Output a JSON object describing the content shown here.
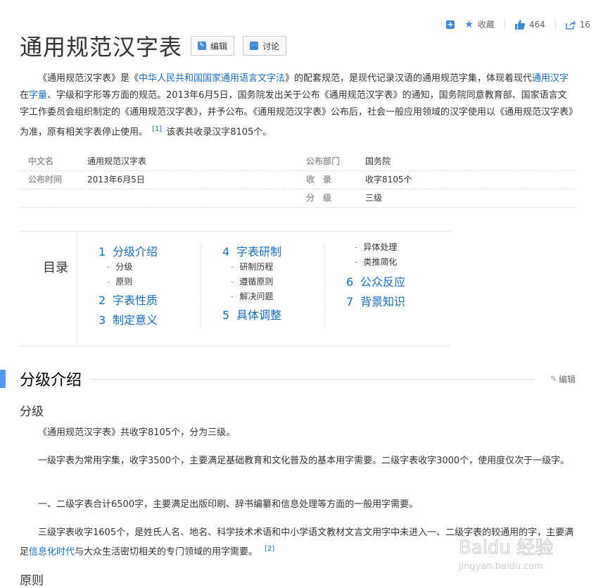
{
  "toolbar": {
    "add_label": "+",
    "favorite_label": "收藏",
    "like_count": "464",
    "share_count": "16"
  },
  "title": "通用规范汉字表",
  "title_buttons": {
    "edit": "编辑",
    "discuss": "讨论"
  },
  "summary": {
    "p1": "《通用规范汉字表》是《",
    "link_law": "中华人民共和国国家通用语言文字法",
    "p2": "》的配套规范，是现代记录汉语的通用规范字集，体现着现代",
    "link_hanzi": "通用汉字",
    "p3": "在",
    "link_ziliang": "字量",
    "p4": "、字级和字形等方面的规范。2013年6月5日，国务院发出关于公布《通用规范汉字表》的通知，国务院同意教育部、国家语言文字工作委员会组织制定的《通用规范汉字表》，并予公布。《通用规范汉字表》公布后，社会一般应用领域的汉字使用以《通用规范汉字表》为准，原有相关字表停止使用。",
    "ref1": "[1]",
    "p5": "该表共收录汉字8105个。"
  },
  "infobox": {
    "rows": [
      {
        "k1": "中文名",
        "v1": "通用规范汉字表",
        "k2": "公布部门",
        "v2": "国务院"
      },
      {
        "k1": "公布时间",
        "v1": "2013年6月5日",
        "k2": "收　录",
        "v2": "收字8105个"
      },
      {
        "k1": "",
        "v1": "",
        "k2": "分　级",
        "v2": "三级"
      }
    ]
  },
  "toc": {
    "label": "目录",
    "cols": [
      [
        {
          "n": "1",
          "t": "分级介绍",
          "subs": [
            "分级",
            "原则"
          ]
        },
        {
          "n": "2",
          "t": "字表性质",
          "subs": []
        },
        {
          "n": "3",
          "t": "制定意义",
          "subs": []
        }
      ],
      [
        {
          "n": "4",
          "t": "字表研制",
          "subs": [
            "研制历程",
            "遵循原则",
            "解决问题"
          ]
        },
        {
          "n": "5",
          "t": "具体调整",
          "subs": []
        }
      ],
      [
        {
          "n": "",
          "t": "",
          "subs": [
            "异体处理",
            "类推简化"
          ]
        },
        {
          "n": "6",
          "t": "公众反应",
          "subs": []
        },
        {
          "n": "7",
          "t": "背景知识",
          "subs": []
        }
      ]
    ]
  },
  "section": {
    "title": "分级介绍",
    "edit": "编辑"
  },
  "subsection1": "分级",
  "paras": {
    "a": "《通用规范汉字表》共收字8105个，分为三级。",
    "b": "一级字表为常用字集，收字3500个，主要满足基础教育和文化普及的基本用字需要。二级字表收字3000个，使用度仅次于一级字。",
    "c": "一、二级字表合计6500字，主要满足出版印刷、辞书编纂和信息处理等方面的一般用字需要。",
    "d1": "三级字表收字1605个，是姓氏人名、地名、科学技术术语和中小学语文教材文言文用字中未进入一、二级字表的较通用的字，主要满足",
    "d_link": "信息化时代",
    "d2": "与大众生活密切相关的专门领域的用字需要。",
    "ref2": "[2]"
  },
  "subsection2": "原则",
  "watermark": {
    "brand": "Baidu 经验",
    "url": "jingyan.baidu.com"
  },
  "colors": {
    "link": "#136ec2",
    "accent": "#4f9cee"
  }
}
